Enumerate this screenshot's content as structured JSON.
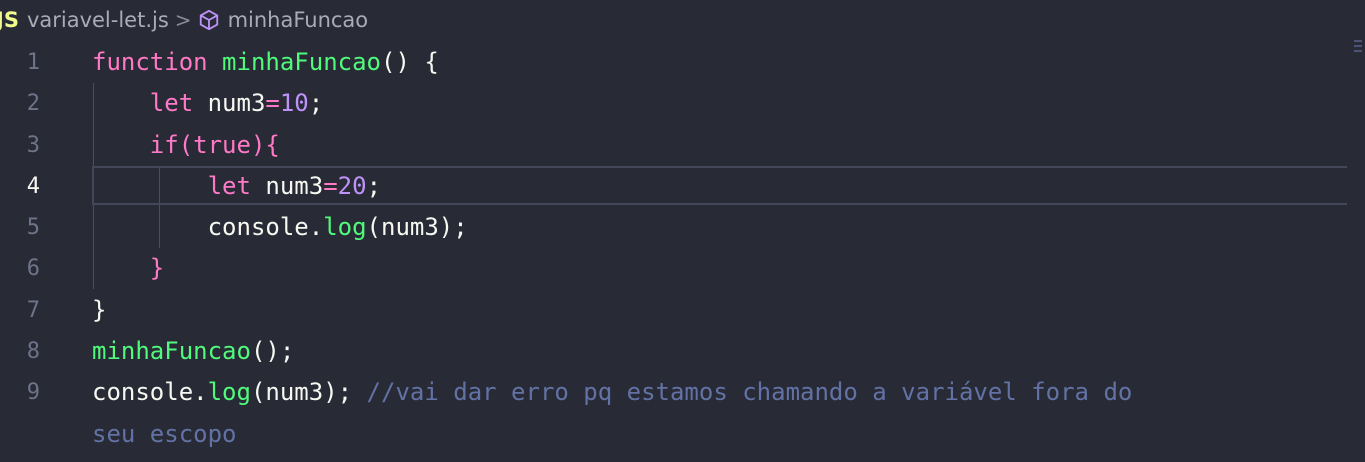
{
  "breadcrumb": {
    "file_badge": "JS",
    "file_name": "variavel-let.js",
    "separator": ">",
    "symbol_name": "minhaFuncao"
  },
  "editor": {
    "active_line": 4,
    "lines": [
      {
        "number": "1",
        "tokens": [
          {
            "cls": "kw",
            "text": "function"
          },
          {
            "cls": "",
            "text": " "
          },
          {
            "cls": "fn",
            "text": "minhaFuncao"
          },
          {
            "cls": "",
            "text": "() {"
          }
        ]
      },
      {
        "number": "2",
        "tokens": [
          {
            "cls": "",
            "text": "    "
          },
          {
            "cls": "kw",
            "text": "let"
          },
          {
            "cls": "",
            "text": " num3"
          },
          {
            "cls": "op",
            "text": "="
          },
          {
            "cls": "num",
            "text": "10"
          },
          {
            "cls": "",
            "text": ";"
          }
        ]
      },
      {
        "number": "3",
        "tokens": [
          {
            "cls": "",
            "text": "    "
          },
          {
            "cls": "kw",
            "text": "if"
          },
          {
            "cls": "op",
            "text": "("
          },
          {
            "cls": "kw",
            "text": "true"
          },
          {
            "cls": "op",
            "text": "){"
          }
        ]
      },
      {
        "number": "4",
        "tokens": [
          {
            "cls": "",
            "text": "        "
          },
          {
            "cls": "kw",
            "text": "let"
          },
          {
            "cls": "",
            "text": " num3"
          },
          {
            "cls": "op",
            "text": "="
          },
          {
            "cls": "num",
            "text": "20"
          },
          {
            "cls": "",
            "text": ";"
          }
        ]
      },
      {
        "number": "5",
        "tokens": [
          {
            "cls": "",
            "text": "        console."
          },
          {
            "cls": "fn",
            "text": "log"
          },
          {
            "cls": "",
            "text": "(num3);"
          }
        ]
      },
      {
        "number": "6",
        "tokens": [
          {
            "cls": "",
            "text": "    "
          },
          {
            "cls": "kw",
            "text": "}"
          }
        ]
      },
      {
        "number": "7",
        "tokens": [
          {
            "cls": "",
            "text": "}"
          }
        ]
      },
      {
        "number": "8",
        "tokens": [
          {
            "cls": "fn",
            "text": "minhaFuncao"
          },
          {
            "cls": "",
            "text": "();"
          }
        ]
      },
      {
        "number": "9",
        "tokens": [
          {
            "cls": "",
            "text": "console."
          },
          {
            "cls": "fn",
            "text": "log"
          },
          {
            "cls": "",
            "text": "(num3); "
          },
          {
            "cls": "com",
            "text": "//vai dar erro pq estamos chamando a variável fora do"
          }
        ]
      },
      {
        "number": "",
        "tokens": [
          {
            "cls": "com",
            "text": "seu escopo"
          }
        ]
      }
    ]
  }
}
